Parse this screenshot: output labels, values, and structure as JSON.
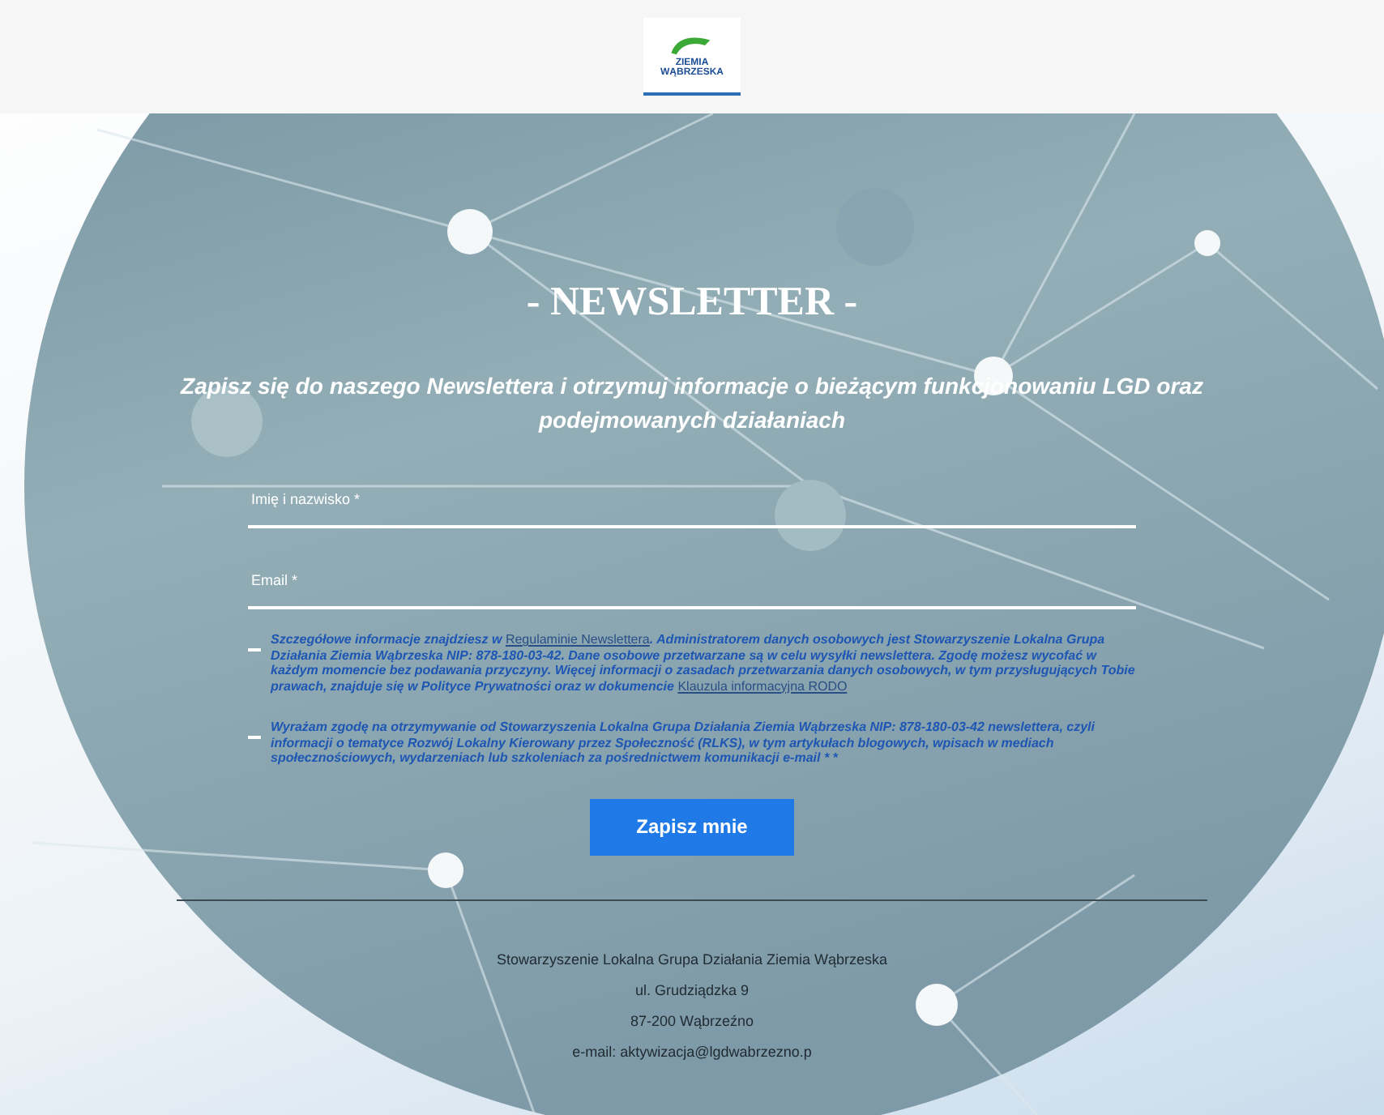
{
  "header": {
    "logo_text": [
      "ZIEMIA",
      "WĄBRZESKA"
    ]
  },
  "newsletter": {
    "title": "- NEWSLETTER -",
    "subtitle": "Zapisz się do naszego Newslettera i otrzymuj informacje o bieżącym funkcjonowaniu LGD oraz podejmowanych działaniach",
    "fields": [
      {
        "placeholder": "Imię i nazwisko *"
      },
      {
        "placeholder": "Email *"
      }
    ],
    "consents": [
      {
        "checked": false,
        "segments": [
          {
            "kind": "text",
            "text": "Szczegółowe informacje znajdziesz w "
          },
          {
            "kind": "link",
            "text": "Regulaminie Newslettera"
          },
          {
            "kind": "text",
            "text": ". Administratorem danych osobowych jest Stowarzyszenie Lokalna Grupa Działania Ziemia Wąbrzeska NIP: 878-180-03-42.  Dane osobowe przetwarzane są w celu wysyłki newslettera. Zgodę możesz wycofać w każdym momencie bez podawania przyczyny. Więcej informacji o zasadach przetwarzania danych osobowych, w tym przysługujących Tobie prawach, znajduje się w Polityce Prywatności oraz w dokumencie "
          },
          {
            "kind": "link",
            "text": "Klauzula informacyjna RODO"
          }
        ]
      },
      {
        "checked": false,
        "segments": [
          {
            "kind": "text",
            "text": "Wyrażam zgodę na otrzymywanie od Stowarzyszenia Lokalna Grupa Działania Ziemia Wąbrzeska NIP: 878-180-03-42 newslettera, czyli informacji o tematyce Rozwój Lokalny Kierowany przez Społeczność (RLKS), w tym artykułach blogowych, wpisach w mediach społecznościowych, wydarzeniach lub szkoleniach za pośrednictwem komunikacji e-mail * *"
          }
        ]
      }
    ],
    "button": "Zapisz mnie"
  },
  "footer": {
    "lines": [
      "Stowarzyszenie Lokalna Grupa Działania Ziemia Wąbrzeska",
      "ul. Grudziądzka 9",
      "87-200 Wąbrzeźno",
      "e-mail: aktywizacja@lgdwabrzezno.p"
    ]
  }
}
